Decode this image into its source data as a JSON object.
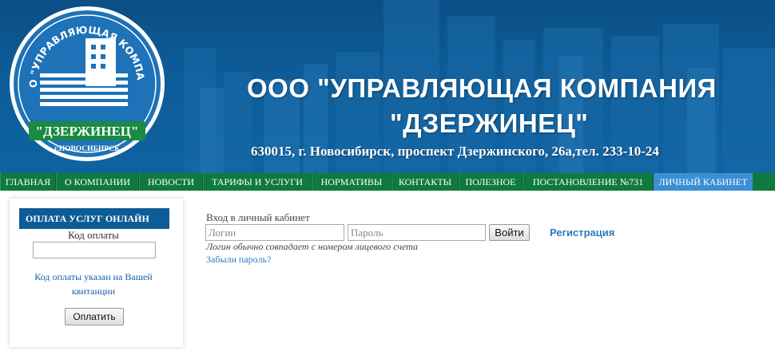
{
  "header": {
    "logo": {
      "arc_text": "ООО \"УПРАВЛЯЮЩАЯ КОМПАНИЯ",
      "ribbon_text": "\"ДЗЕРЖИНЕЦ\"",
      "city_text": "г.НОВОСИБИРСК"
    },
    "title_line1": "ООО \"УПРАВЛЯЮЩАЯ КОМПАНИЯ",
    "title_line2": "\"ДЗЕРЖИНЕЦ\"",
    "address": "630015, г. Новосибирск, проспект Дзержинского, 26а,тел. 233-10-24"
  },
  "nav": {
    "items": [
      {
        "label": "ГЛАВНАЯ"
      },
      {
        "label": "О КОМПАНИИ"
      },
      {
        "label": "НОВОСТИ"
      },
      {
        "label": "ТАРИФЫ И УСЛУГИ"
      },
      {
        "label": "НОРМАТИВЫ"
      },
      {
        "label": "КОНТАКТЫ"
      },
      {
        "label": "ПОЛЕЗНОЕ"
      },
      {
        "label": "ПОСТАНОВЛЕНИЕ №731"
      },
      {
        "label": "ЛИЧНЫЙ КАБИНЕТ"
      }
    ],
    "active": "ЛИЧНЫЙ КАБИНЕТ"
  },
  "payment": {
    "heading": "ОПЛАТА УСЛУГ ОНЛАЙН",
    "code_label": "Код оплаты",
    "code_value": "",
    "hint": "Код оплаты указан на Вашей квитанции",
    "pay_button": "Оплатить"
  },
  "login": {
    "title": "Вход в личный кабинет",
    "login_placeholder": "Логин",
    "password_placeholder": "Пароль",
    "submit_button": "Войти",
    "register_link": "Регистрация",
    "note": "Логин обычно совпадает с номером лицевого счета",
    "forgot_link": "Забыли пароль?"
  },
  "colors": {
    "header_blue": "#0d5c98",
    "nav_green": "#0f7a3d",
    "nav_active": "#3a8fd6",
    "link_blue": "#2a7ac0"
  }
}
